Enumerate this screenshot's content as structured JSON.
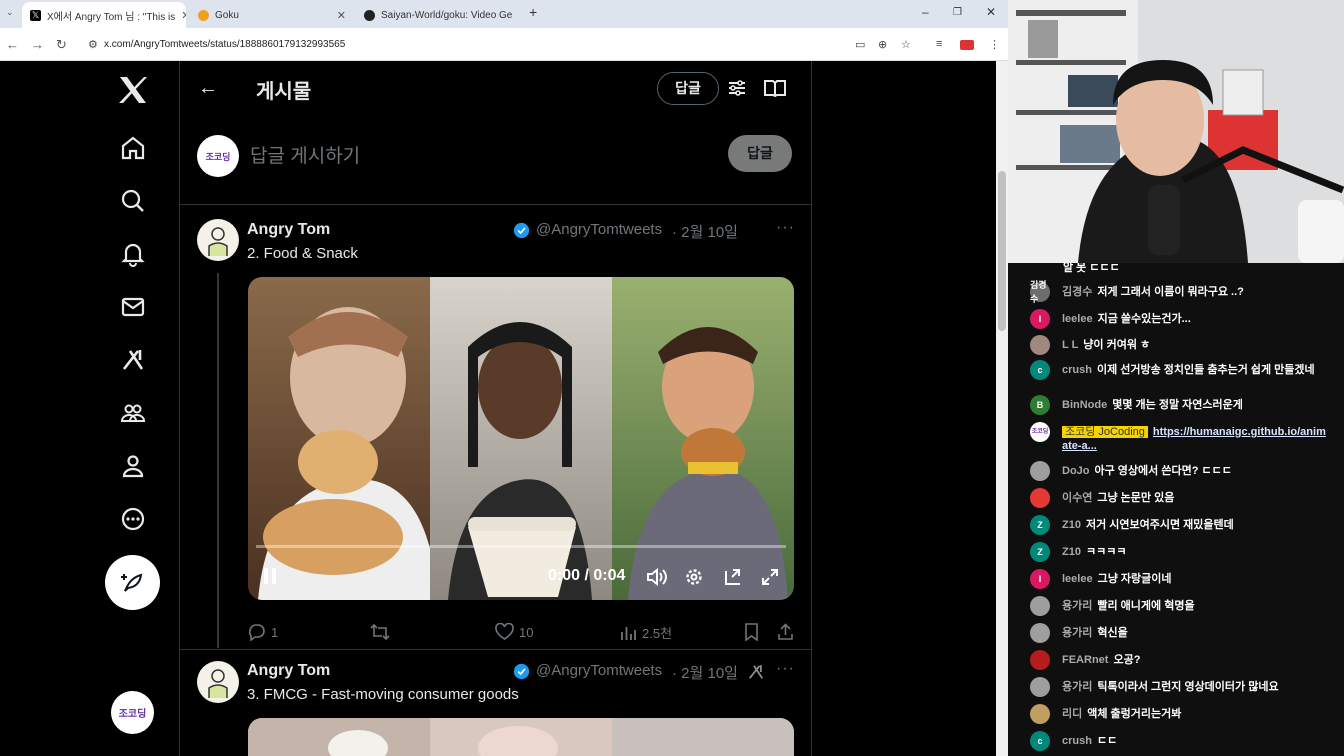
{
  "browser": {
    "tabs": [
      {
        "label": "X에서 Angry Tom 님 : \"This is",
        "favicon": "x-favicon",
        "active": true
      },
      {
        "label": "Goku",
        "favicon": "goku-favicon",
        "active": false
      },
      {
        "label": "Saiyan-World/goku: Video Ge",
        "favicon": "github-favicon",
        "active": false
      }
    ],
    "url": "x.com/AngryTomtweets/status/1888860179132993565"
  },
  "x": {
    "page_title": "게시물",
    "header_reply_button": "답글",
    "composer_placeholder": "답글 게시하기",
    "composer_button": "답글",
    "avatar_label": "조코딩",
    "posts": [
      {
        "name": "Angry Tom",
        "handle": "@AngryTomtweets",
        "date": "· 2월 10일",
        "text": "2. Food & Snack",
        "video_time": "0:00 / 0:04",
        "replies": "1",
        "likes": "10",
        "views": "2.5천"
      },
      {
        "name": "Angry Tom",
        "handle": "@AngryTomtweets",
        "date": "· 2월 10일",
        "text": "3. FMCG - Fast-moving consumer goods"
      }
    ]
  },
  "chat": {
    "top_partial": "알 못 ㄷㄷㄷ",
    "messages": [
      {
        "name": "김경수",
        "text": "저게 그래서 이름이 뭐라구요 ..?",
        "avatar": "김경수",
        "color": "#6e6e6e"
      },
      {
        "name": "leelee",
        "text": "지금 쓸수있는건가...",
        "avatar": "l",
        "color": "#d81b60"
      },
      {
        "name": "L L",
        "text": "냥이 커여워 ㅎ",
        "avatar": "",
        "color": "#a1887f"
      },
      {
        "name": "crush",
        "text": "이제 선거방송 정치인들 춤추는거 쉽게 만들겠네",
        "avatar": "c",
        "color": "#00897b"
      },
      {
        "name": "BinNode",
        "text": "몇몇 개는 정말 자연스러운게",
        "avatar": "B",
        "color": "#2e7d32"
      },
      {
        "name": "조코딩 JoCoding",
        "text": "https://humanaigc.github.io/animate-a...",
        "avatar": "조코딩",
        "color": "#ffffff",
        "owner": true
      },
      {
        "name": "DoJo",
        "text": "아구 영상에서 쓴다면? ㄷㄷㄷ",
        "avatar": "",
        "color": "#9e9e9e"
      },
      {
        "name": "이수연",
        "text": "그냥 논문만 있음",
        "avatar": "",
        "color": "#e53935"
      },
      {
        "name": "Z10",
        "text": "저거 시연보여주시면 재밌을텐데",
        "avatar": "Z",
        "color": "#00897b"
      },
      {
        "name": "Z10",
        "text": "ㅋㅋㅋㅋ",
        "avatar": "Z",
        "color": "#00897b"
      },
      {
        "name": "leelee",
        "text": "그냥 자랑글이네",
        "avatar": "l",
        "color": "#d81b60"
      },
      {
        "name": "용가리",
        "text": "빨리 애니게에 혁명을",
        "avatar": "",
        "color": "#9e9e9e"
      },
      {
        "name": "용가리",
        "text": "혁신을",
        "avatar": "",
        "color": "#9e9e9e"
      },
      {
        "name": "FEARnet",
        "text": "오공?",
        "avatar": "",
        "color": "#b71c1c"
      },
      {
        "name": "용가리",
        "text": "틱톡이라서 그런지 영상데이터가 많네요",
        "avatar": "",
        "color": "#9e9e9e"
      },
      {
        "name": "리디",
        "text": "액체 출렁거리는거봐",
        "avatar": "",
        "color": "#c0a060"
      },
      {
        "name": "crush",
        "text": "ㄷㄷ",
        "avatar": "c",
        "color": "#00897b"
      }
    ]
  }
}
